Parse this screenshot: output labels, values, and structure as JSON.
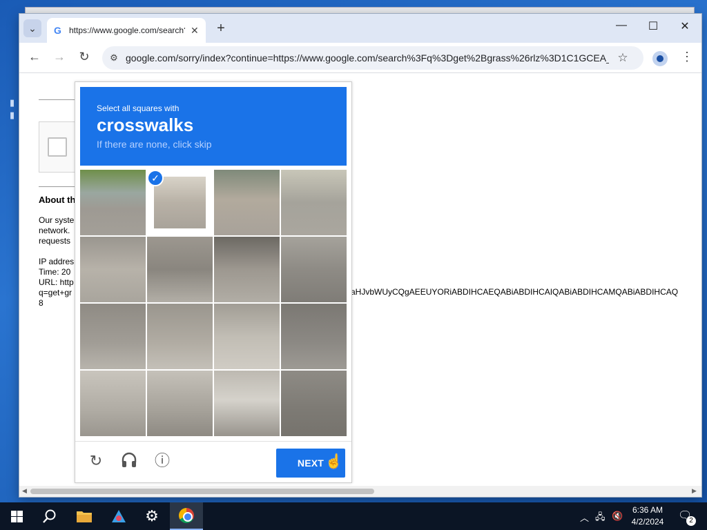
{
  "browser": {
    "tab_title": "https://www.google.com/search?q=get+gr",
    "tab_favicon": "G",
    "url": "google.com/sorry/index?continue=https://www.google.com/search%3Fq%3Dget%2Bgrass%26rlz%3D1C1GCEA_..."
  },
  "page": {
    "about_heading": "About th",
    "lines1": [
      "Our syste",
      "network.",
      "requests"
    ],
    "lines2": [
      "IP addres",
      "Time: 20",
      "URL: http",
      "q=get+gr",
      "8"
    ],
    "long_query": "aHJvbWUyCQgAEEUYORiABDIHCAEQABiABDIHCAIQABiABDIHCAMQABiABDIHCAQ"
  },
  "captcha": {
    "instruction": "Select all squares with",
    "target": "crosswalks",
    "hint": "If there are none, click skip",
    "next_label": "NEXT",
    "selected_tiles": [
      1
    ],
    "check_glyph": "✓"
  },
  "icons": {
    "reload": "↻",
    "audio": "🎧",
    "info": "ⓘ",
    "back": "←",
    "forward": "→",
    "refresh": "↻",
    "star": "☆",
    "kebab": "⋮",
    "close": "✕",
    "plus": "+",
    "chevron": "⌄",
    "minimize": "—",
    "maximize": "☐",
    "winclose": "✕",
    "search": "⚲",
    "tune": "⚙"
  },
  "taskbar": {
    "time": "6:36 AM",
    "date": "4/2/2024",
    "notif_count": "2"
  },
  "colors": {
    "accent": "#1a73e8",
    "taskbar": "#0b1525"
  }
}
